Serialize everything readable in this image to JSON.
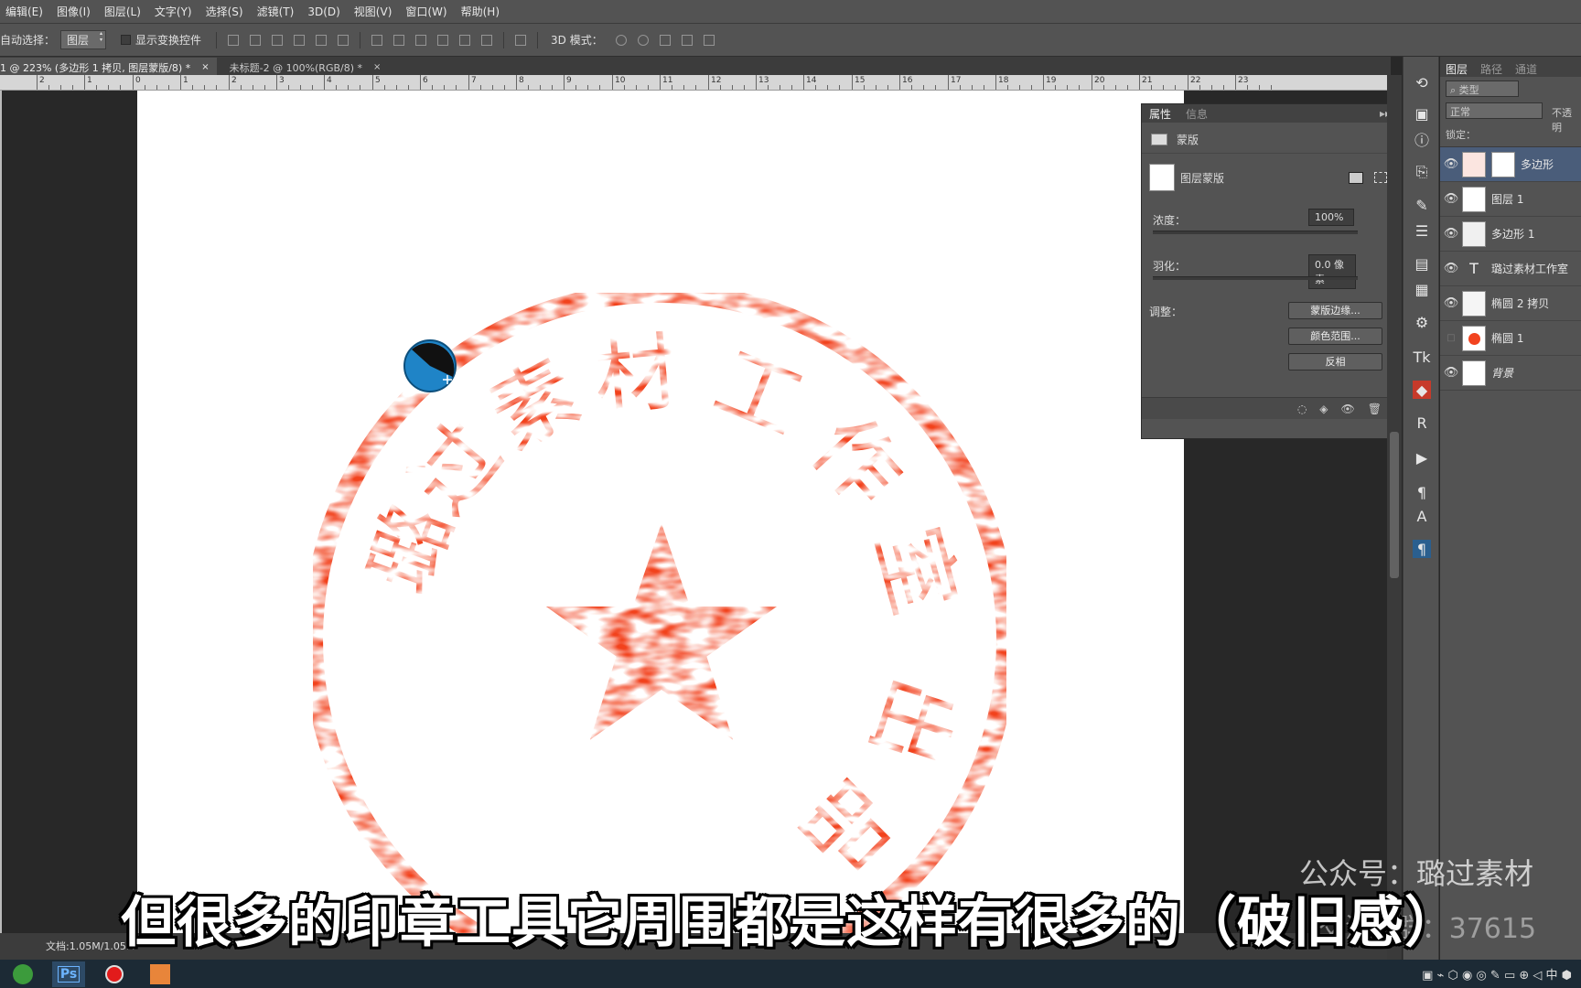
{
  "menu": [
    "编辑(E)",
    "图像(I)",
    "图层(L)",
    "文字(Y)",
    "选择(S)",
    "滤镜(T)",
    "3D(D)",
    "视图(V)",
    "窗口(W)",
    "帮助(H)"
  ],
  "options": {
    "auto_select_label": "自动选择：",
    "auto_select_value": "图层",
    "transform_label": "显示变换控件",
    "mode3d_label": "3D 模式："
  },
  "tabs": [
    {
      "label": "1 @ 223% (多边形 1 拷贝, 图层蒙版/8) *",
      "close": "×"
    },
    {
      "label": "未标题-2 @ 100%(RGB/8) *",
      "close": "×"
    }
  ],
  "ruler_numbers": [
    "2",
    "1",
    "0",
    "1",
    "2",
    "3",
    "4",
    "5",
    "6",
    "7",
    "8",
    "9",
    "10",
    "11",
    "12",
    "13",
    "14",
    "15",
    "16",
    "17",
    "18",
    "19",
    "20",
    "21",
    "22",
    "23"
  ],
  "stamp": {
    "arc_chars": [
      "璐",
      "过",
      "素",
      "材",
      "工",
      "作",
      "室",
      "出",
      "品"
    ],
    "color": "#f2431f"
  },
  "properties": {
    "tab_properties": "属性",
    "tab_info": "信息",
    "mask_type": "蒙版",
    "layer_mask": "图层蒙版",
    "density_label": "浓度：",
    "density_value": "100%",
    "feather_label": "羽化：",
    "feather_value": "0.0 像素",
    "adjust_label": "调整：",
    "btn_mask_edge": "蒙版边缘...",
    "btn_color_range": "颜色范围...",
    "btn_invert": "反相"
  },
  "layers_panel": {
    "tabs": [
      "图层",
      "路径",
      "通道"
    ],
    "filter": "类型",
    "blend": "正常",
    "opacity_label": "不透明",
    "lock_label": "锁定：",
    "layers": [
      {
        "name": "多边形",
        "visible": true,
        "selected": true
      },
      {
        "name": "图层 1",
        "visible": true,
        "selected": false
      },
      {
        "name": "多边形 1",
        "visible": true,
        "selected": false
      },
      {
        "name": "璐过素材工作室",
        "visible": true,
        "selected": false
      },
      {
        "name": "椭圆 2 拷贝",
        "visible": true,
        "selected": false
      },
      {
        "name": "椭圆 1",
        "visible": false,
        "selected": false
      },
      {
        "name": "背景",
        "visible": true,
        "selected": false
      }
    ]
  },
  "status": {
    "doc": "文档:1.05M/1.05M"
  },
  "subtitle": "但很多的印章工具它周围都是这样有很多的（破旧感）",
  "watermark": {
    "line1": "公众号：璐过素材",
    "line2": "交流Q群：37615"
  }
}
